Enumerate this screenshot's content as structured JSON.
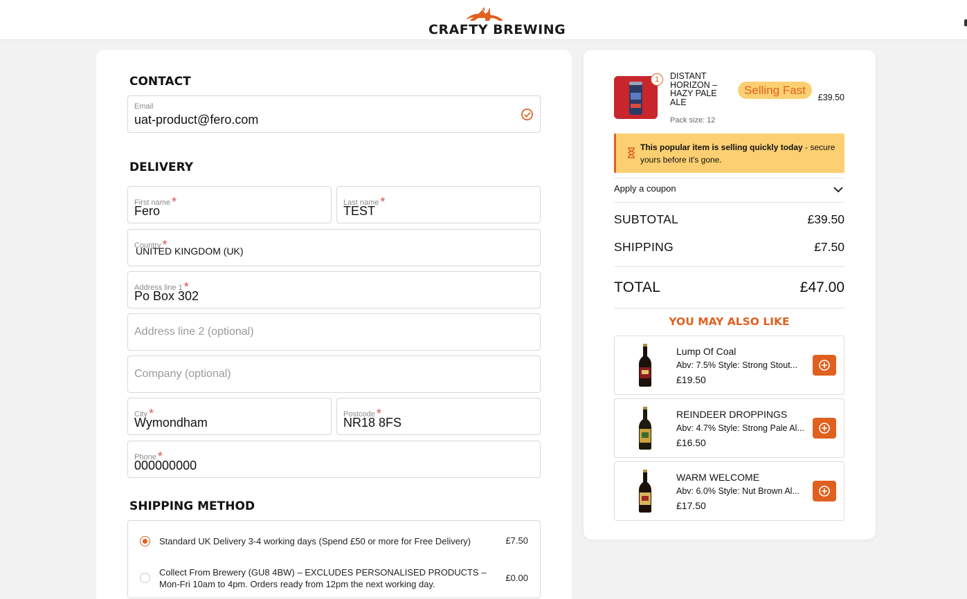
{
  "brand": {
    "name": "CRAFTY BREWING",
    "accent": "#e0601f"
  },
  "contact": {
    "title": "CONTACT",
    "email_label": "Email",
    "email_value": "uat-product@fero.com"
  },
  "delivery": {
    "title": "DELIVERY",
    "first_name_label": "First name",
    "first_name_value": "Fero",
    "last_name_label": "Last name",
    "last_name_value": "TEST",
    "country_label": "Country",
    "country_value": "UNITED KINGDOM (UK)",
    "address1_label": "Address line 1",
    "address1_value": "Po Box 302",
    "address2_placeholder": "Address line 2 (optional)",
    "company_placeholder": "Company (optional)",
    "city_label": "City",
    "city_value": "Wymondham",
    "postcode_label": "Postcode",
    "postcode_value": "NR18 8FS",
    "phone_label": "Phone",
    "phone_value": "000000000",
    "required_mark": "*"
  },
  "shipping": {
    "title": "SHIPPING METHOD",
    "options": [
      {
        "label": "Standard UK Delivery 3-4 working days (Spend £50 or more for Free Delivery)",
        "price": "£7.50",
        "selected": true
      },
      {
        "label": "Collect From Brewery (GU8 4BW) – EXCLUDES PERSONALISED PRODUCTS – Mon-Fri 10am to 4pm. Orders ready from 12pm the next working day.",
        "price": "£0.00",
        "selected": false
      }
    ]
  },
  "cart": {
    "item": {
      "name": "DISTANT HORIZON – HAZY PALE ALE",
      "qty": "1",
      "pack": "Pack size: 12",
      "badge": "Selling Fast",
      "price": "£39.50"
    },
    "alert_bold": "This popular item is selling quickly today",
    "alert_rest": " - secure yours before it's gone.",
    "coupon_label": "Apply a coupon",
    "subtotal_label": "SUBTOTAL",
    "subtotal_value": "£39.50",
    "shipping_label": "SHIPPING",
    "shipping_value": "£7.50",
    "total_label": "TOTAL",
    "total_value": "£47.00"
  },
  "recommendations": {
    "title": "YOU MAY ALSO LIKE",
    "items": [
      {
        "name": "Lump Of Coal",
        "desc": "Abv: 7.5% Style: Strong Stout...",
        "price": "£19.50"
      },
      {
        "name": "REINDEER DROPPINGS",
        "desc": "Abv: 4.7% Style: Strong Pale Al...",
        "price": "£16.50"
      },
      {
        "name": "WARM WELCOME",
        "desc": "Abv: 6.0% Style: Nut Brown Al...",
        "price": "£17.50"
      }
    ]
  }
}
